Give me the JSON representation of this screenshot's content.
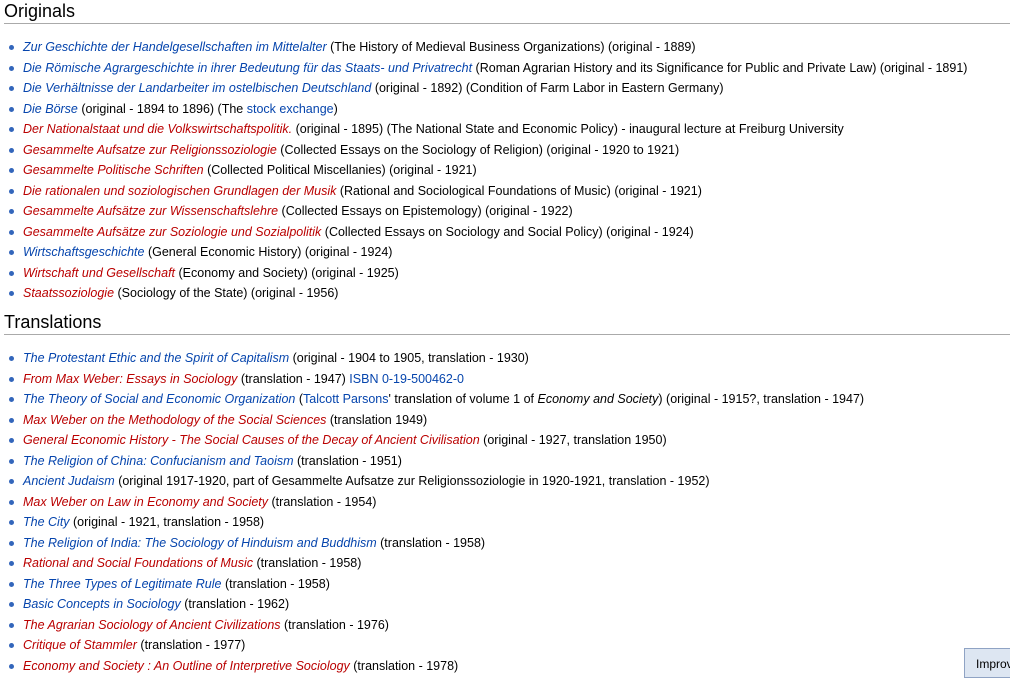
{
  "originals": {
    "heading": "Originals",
    "items": [
      {
        "link": "Zur Geschichte der Handelgesellschaften im Mittelalter",
        "link_color": "blue",
        "rest": " (The History of Medieval Business Organizations) (original - 1889)"
      },
      {
        "link": "Die Römische Agrargeschichte in ihrer Bedeutung für das Staats- und Privatrecht",
        "link_color": "blue",
        "rest": " (Roman Agrarian History and its Significance for Public and Private Law) (original - 1891)"
      },
      {
        "link": "Die Verhältnisse der Landarbeiter im ostelbischen Deutschland",
        "link_color": "blue",
        "rest": " (original - 1892) (Condition of Farm Labor in Eastern Germany)"
      },
      {
        "link": "Die Börse",
        "link_color": "blue",
        "rest": " (original - 1894 to 1896) (The ",
        "link2": "stock exchange",
        "rest2": ")"
      },
      {
        "link": "Der Nationalstaat und die Volkswirtschaftspolitik.",
        "link_color": "red",
        "rest": " (original - 1895) (The National State and Economic Policy) - inaugural lecture at Freiburg University"
      },
      {
        "link": "Gesammelte Aufsatze zur Religionssoziologie",
        "link_color": "red",
        "rest": " (Collected Essays on the Sociology of Religion) (original - 1920 to 1921)"
      },
      {
        "link": "Gesammelte Politische Schriften",
        "link_color": "red",
        "rest": " (Collected Political Miscellanies) (original - 1921)"
      },
      {
        "link": "Die rationalen und soziologischen Grundlagen der Musik",
        "link_color": "red",
        "rest": " (Rational and Sociological Foundations of Music) (original - 1921)"
      },
      {
        "link": "Gesammelte Aufsätze zur Wissenschaftslehre",
        "link_color": "red",
        "rest": " (Collected Essays on Epistemology) (original - 1922)"
      },
      {
        "link": "Gesammelte Aufsätze zur Soziologie und Sozialpolitik",
        "link_color": "red",
        "rest": " (Collected Essays on Sociology and Social Policy) (original - 1924)"
      },
      {
        "link": "Wirtschaftsgeschichte",
        "link_color": "blue",
        "rest": " (General Economic History) (original - 1924)"
      },
      {
        "link": "Wirtschaft und Gesellschaft",
        "link_color": "red",
        "rest": " (Economy and Society) (original - 1925)"
      },
      {
        "link": "Staatssoziologie",
        "link_color": "red",
        "rest": " (Sociology of the State) (original - 1956)"
      }
    ]
  },
  "translations": {
    "heading": "Translations",
    "items": [
      {
        "link": "The Protestant Ethic and the Spirit of Capitalism",
        "link_color": "blue",
        "rest": " (original - 1904 to 1905, translation - 1930)"
      },
      {
        "link": "From Max Weber: Essays in Sociology",
        "link_color": "red",
        "rest": " (translation - 1947) ",
        "link2": "ISBN 0-19-500462-0",
        "rest2": ""
      },
      {
        "link": "The Theory of Social and Economic Organization",
        "link_color": "blue",
        "rest": " (",
        "link2": "Talcott Parsons",
        "rest2": "' translation of volume 1 of ",
        "ital": "Economy and Society",
        "rest3": ") (original - 1915?, translation - 1947)"
      },
      {
        "link": "Max Weber on the Methodology of the Social Sciences",
        "link_color": "red",
        "rest": " (translation 1949)"
      },
      {
        "link": "General Economic History - The Social Causes of the Decay of Ancient Civilisation",
        "link_color": "red",
        "rest": " (original - 1927, translation 1950)"
      },
      {
        "link": "The Religion of China: Confucianism and Taoism",
        "link_color": "blue",
        "rest": " (translation - 1951)"
      },
      {
        "link": "Ancient Judaism",
        "link_color": "blue",
        "rest": " (original 1917-1920, part of Gesammelte Aufsatze zur Religionssoziologie in 1920-1921, translation - 1952)"
      },
      {
        "link": "Max Weber on Law in Economy and Society",
        "link_color": "red",
        "rest": " (translation - 1954)"
      },
      {
        "link": "The City",
        "link_color": "blue",
        "rest": " (original - 1921, translation - 1958)"
      },
      {
        "link": "The Religion of India: The Sociology of Hinduism and Buddhism",
        "link_color": "blue",
        "rest": " (translation - 1958)"
      },
      {
        "link": "Rational and Social Foundations of Music",
        "link_color": "red",
        "rest": " (translation - 1958)"
      },
      {
        "link": "The Three Types of Legitimate Rule",
        "link_color": "blue",
        "rest": " (translation - 1958)"
      },
      {
        "link": "Basic Concepts in Sociology",
        "link_color": "blue",
        "rest": " (translation - 1962)"
      },
      {
        "link": "The Agrarian Sociology of Ancient Civilizations",
        "link_color": "red",
        "rest": " (translation - 1976)"
      },
      {
        "link": "Critique of Stammler",
        "link_color": "red",
        "rest": " (translation - 1977)"
      },
      {
        "link": "Economy and Society : An Outline of Interpretive Sociology",
        "link_color": "red",
        "rest": " (translation - 1978)"
      }
    ]
  },
  "improve_button": {
    "label": "Improve"
  },
  "colors": {
    "link_blue": "#0645ad",
    "link_red": "#ba0000",
    "bullet": "#3366bb"
  }
}
